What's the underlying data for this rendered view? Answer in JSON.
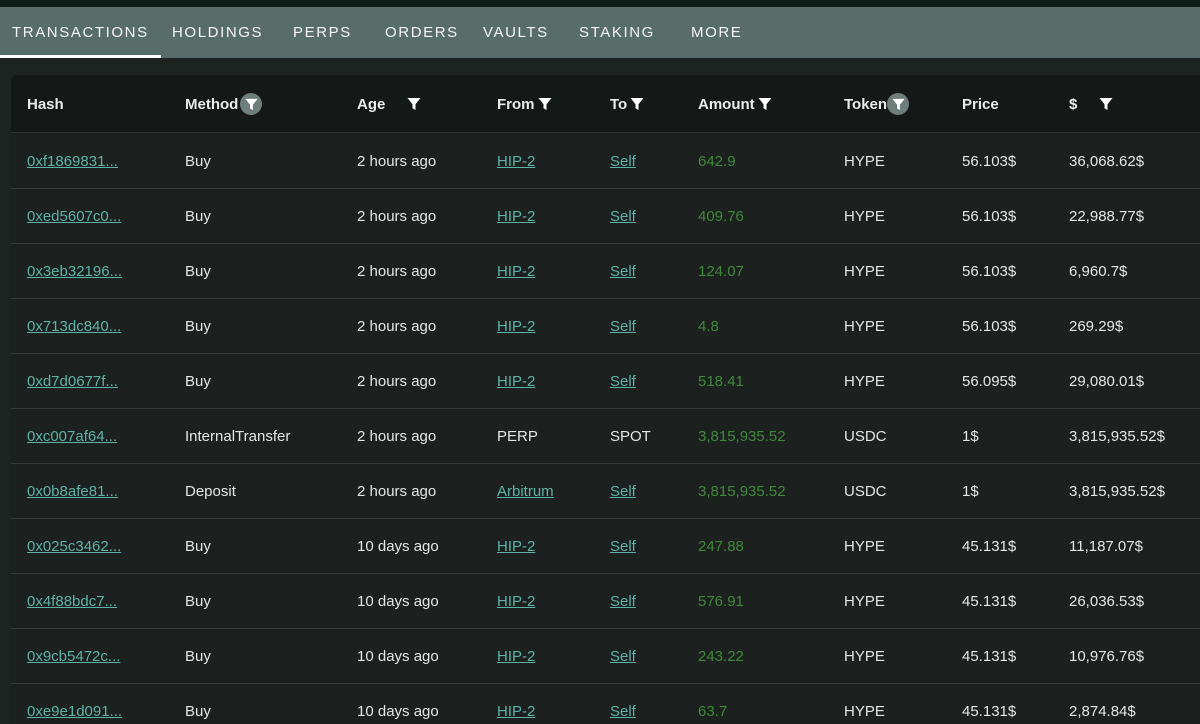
{
  "tabs": [
    {
      "label": "TRANSACTIONS",
      "active": true
    },
    {
      "label": "HOLDINGS"
    },
    {
      "label": "PERPS"
    },
    {
      "label": "ORDERS"
    },
    {
      "label": "VAULTS"
    },
    {
      "label": "STAKING"
    },
    {
      "label": "MORE"
    }
  ],
  "columns": {
    "hash": "Hash",
    "method": "Method",
    "age": "Age",
    "from": "From",
    "to": "To",
    "amount": "Amount",
    "token": "Token",
    "price": "Price",
    "usd": "$"
  },
  "rows": [
    {
      "hash": "0xf1869831...",
      "method": "Buy",
      "age": "2 hours ago",
      "from": "HIP-2",
      "to": "Self",
      "amount": "642.9",
      "token": "HYPE",
      "price": "56.103$",
      "usd": "36,068.62$"
    },
    {
      "hash": "0xed5607c0...",
      "method": "Buy",
      "age": "2 hours ago",
      "from": "HIP-2",
      "to": "Self",
      "amount": "409.76",
      "token": "HYPE",
      "price": "56.103$",
      "usd": "22,988.77$"
    },
    {
      "hash": "0x3eb32196...",
      "method": "Buy",
      "age": "2 hours ago",
      "from": "HIP-2",
      "to": "Self",
      "amount": "124.07",
      "token": "HYPE",
      "price": "56.103$",
      "usd": "6,960.7$"
    },
    {
      "hash": "0x713dc840...",
      "method": "Buy",
      "age": "2 hours ago",
      "from": "HIP-2",
      "to": "Self",
      "amount": "4.8",
      "token": "HYPE",
      "price": "56.103$",
      "usd": "269.29$"
    },
    {
      "hash": "0xd7d0677f...",
      "method": "Buy",
      "age": "2 hours ago",
      "from": "HIP-2",
      "to": "Self",
      "amount": "518.41",
      "token": "HYPE",
      "price": "56.095$",
      "usd": "29,080.01$"
    },
    {
      "hash": "0xc007af64...",
      "method": "InternalTransfer",
      "age": "2 hours ago",
      "from": "PERP",
      "to": "SPOT",
      "amount": "3,815,935.52",
      "token": "USDC",
      "price": "1$",
      "usd": "3,815,935.52$"
    },
    {
      "hash": "0x0b8afe81...",
      "method": "Deposit",
      "age": "2 hours ago",
      "from": "Arbitrum",
      "to": "Self",
      "amount": "3,815,935.52",
      "token": "USDC",
      "price": "1$",
      "usd": "3,815,935.52$"
    },
    {
      "hash": "0x025c3462...",
      "method": "Buy",
      "age": "10 days ago",
      "from": "HIP-2",
      "to": "Self",
      "amount": "247.88",
      "token": "HYPE",
      "price": "45.131$",
      "usd": "11,187.07$"
    },
    {
      "hash": "0x4f88bdc7...",
      "method": "Buy",
      "age": "10 days ago",
      "from": "HIP-2",
      "to": "Self",
      "amount": "576.91",
      "token": "HYPE",
      "price": "45.131$",
      "usd": "26,036.53$"
    },
    {
      "hash": "0x9cb5472c...",
      "method": "Buy",
      "age": "10 days ago",
      "from": "HIP-2",
      "to": "Self",
      "amount": "243.22",
      "token": "HYPE",
      "price": "45.131$",
      "usd": "10,976.76$"
    },
    {
      "hash": "0xe9e1d091...",
      "method": "Buy",
      "age": "10 days ago",
      "from": "HIP-2",
      "to": "Self",
      "amount": "63.7",
      "token": "HYPE",
      "price": "45.131$",
      "usd": "2,874.84$"
    }
  ],
  "colors": {
    "tab_bar": "#586d69",
    "link": "#5fb3a6",
    "amount": "#3f8a3a",
    "header_bg": "#141918",
    "row_bg": "#1c201f"
  }
}
